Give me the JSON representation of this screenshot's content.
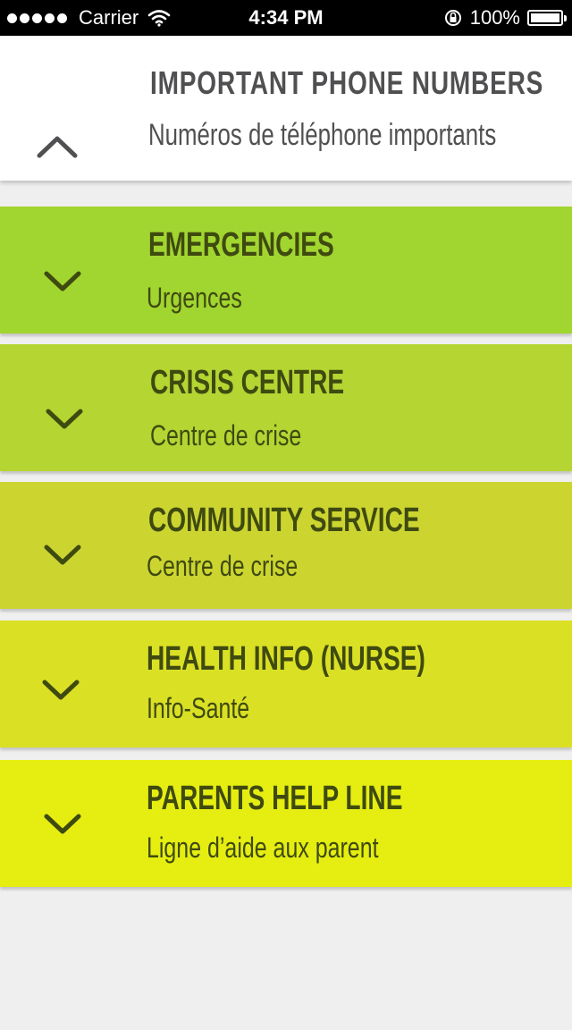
{
  "status_bar": {
    "carrier": "Carrier",
    "time": "4:34 PM",
    "battery": "100%"
  },
  "header": {
    "title": "IMPORTANT PHONE NUMBERS",
    "subtitle": "Numéros de téléphone importants"
  },
  "sections": [
    {
      "title": "EMERGENCIES",
      "subtitle": "Urgences",
      "color": "#a1d530"
    },
    {
      "title": "CRISIS CENTRE",
      "subtitle": "Centre de crise",
      "color": "#b4d532"
    },
    {
      "title": "COMMUNITY SERVICE",
      "subtitle": "Centre de crise",
      "color": "#ccd530"
    },
    {
      "title": "HEALTH INFO (NURSE)",
      "subtitle": "Info-Santé",
      "color": "#dae024"
    },
    {
      "title": "PARENTS HELP LINE",
      "subtitle": "Ligne d’aide aux parent",
      "color": "#e5ee10"
    }
  ],
  "icons": {
    "header": "chevron-up-icon",
    "section": "chevron-down-icon"
  },
  "colors": {
    "text_dark_green": "#3f4a10",
    "header_text": "#505052",
    "background": "#efefef"
  }
}
